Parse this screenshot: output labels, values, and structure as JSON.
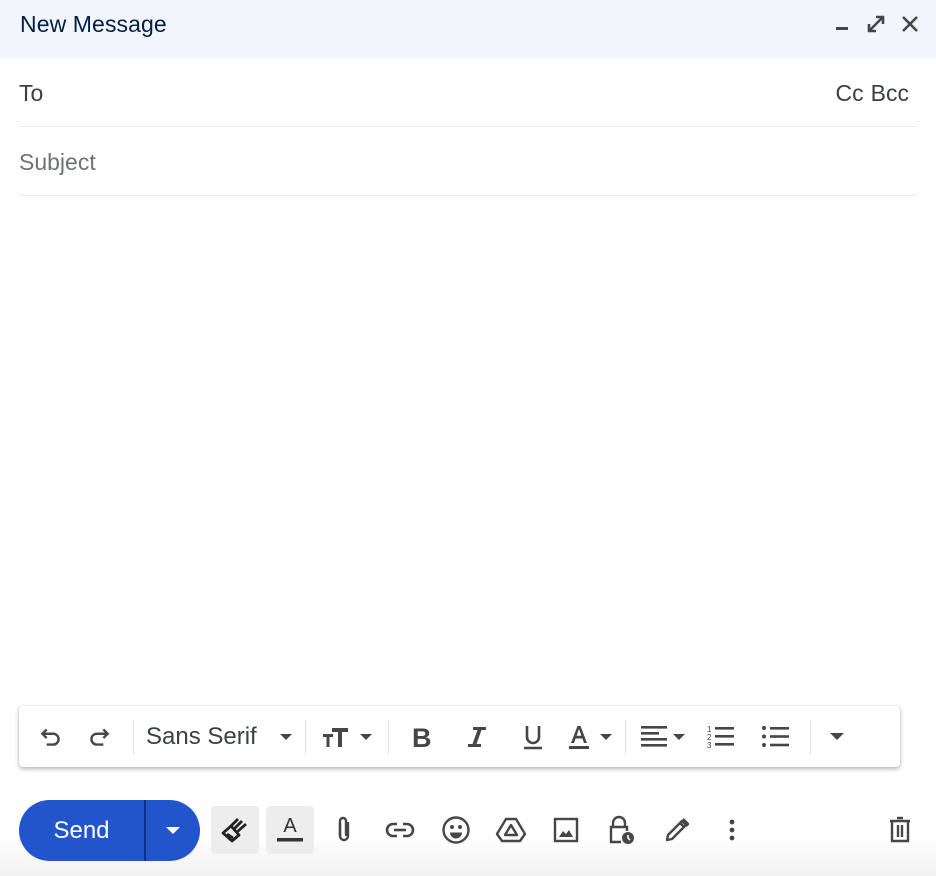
{
  "header": {
    "title": "New Message",
    "icons": [
      "minimize-icon",
      "fullscreen-icon",
      "close-icon"
    ]
  },
  "recipients": {
    "to_label": "To",
    "to_value": "",
    "cc_label": "Cc",
    "bcc_label": "Bcc"
  },
  "subject": {
    "placeholder": "Subject",
    "value": ""
  },
  "body": {
    "value": ""
  },
  "formatting_toolbar": {
    "font_family": "Sans Serif",
    "buttons": [
      "undo",
      "redo",
      "font-family",
      "font-size",
      "bold",
      "italic",
      "underline",
      "text-color",
      "align",
      "numbered-list",
      "bulleted-list",
      "more-formatting"
    ]
  },
  "bottom_toolbar": {
    "send_label": "Send",
    "buttons": [
      "formatting-options",
      "text-formatting",
      "attach-files",
      "insert-link",
      "insert-emoji",
      "insert-drive",
      "insert-photo",
      "confidential-mode",
      "insert-signature",
      "more-options",
      "discard-draft"
    ]
  },
  "colors": {
    "send_button": "#2255cc",
    "header_bg": "#f2f6fc",
    "title_text": "#041e49"
  }
}
